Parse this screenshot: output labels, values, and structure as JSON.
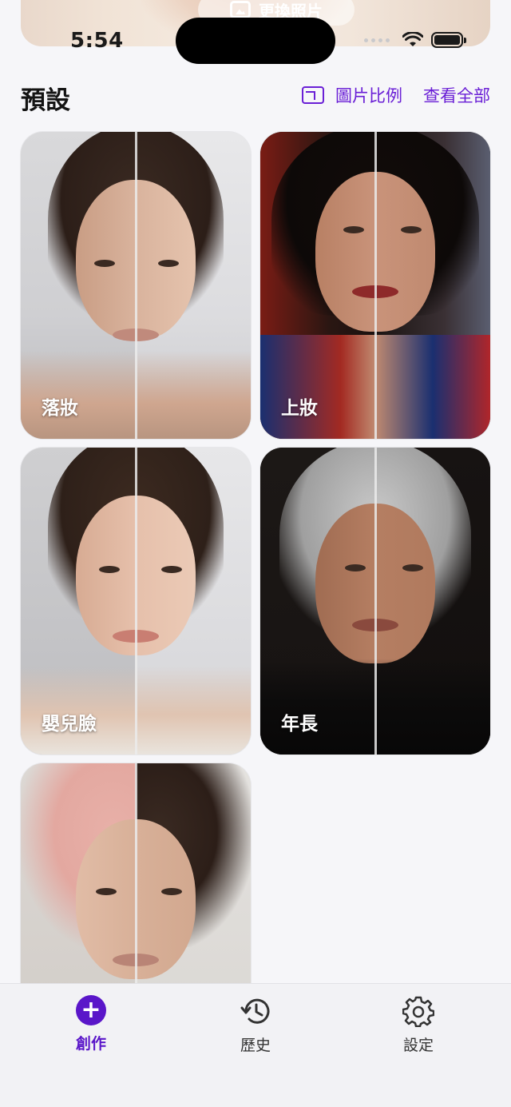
{
  "status_bar": {
    "time": "5:54"
  },
  "top_card": {
    "change_photo_label": "更換照片"
  },
  "presets": {
    "title": "預設",
    "ratio_label": "圖片比例",
    "view_all_label": "查看全部",
    "items": [
      {
        "label": "落妝"
      },
      {
        "label": "上妝"
      },
      {
        "label": "嬰兒臉"
      },
      {
        "label": "年長"
      },
      {
        "label": ""
      }
    ]
  },
  "tabbar": {
    "create_label": "創作",
    "history_label": "歷史",
    "settings_label": "設定"
  },
  "colors": {
    "accent": "#5a16c9",
    "background": "#f6f6f9"
  }
}
